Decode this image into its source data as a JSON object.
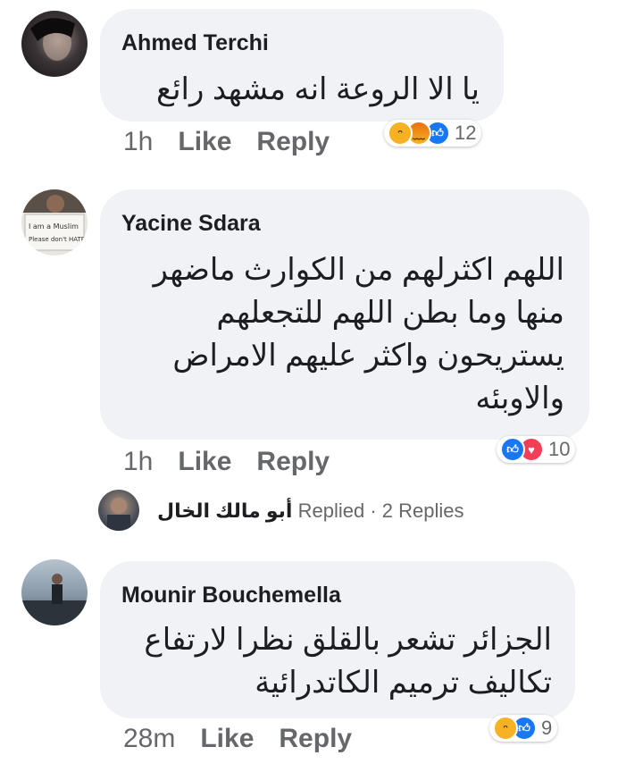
{
  "comments": [
    {
      "author": "Ahmed Terchi",
      "text_lines": [
        "يا الا الروعة  انه مشهد رائع"
      ],
      "time": "1h",
      "like_label": "Like",
      "reply_label": "Reply",
      "reactions": [
        "haha",
        "angry",
        "like"
      ],
      "reaction_count": "12"
    },
    {
      "author": "Yacine Sdara",
      "text_lines": [
        "اللهم اكثرلهم من الكوارث ماضهر",
        "منها وما بطن اللهم للتجعلهم",
        "يستريحون واكثر عليهم الامراض",
        "والاوبئه"
      ],
      "time": "1h",
      "like_label": "Like",
      "reply_label": "Reply",
      "reactions": [
        "like",
        "love"
      ],
      "reaction_count": "10",
      "replies": {
        "replier": "أبو مالك الخال",
        "replied_label": "Replied",
        "separator": "·",
        "count_label": "2 Replies"
      }
    },
    {
      "author": "Mounir Bouchemella",
      "text_lines": [
        "الجزائر تشعر بالقلق نظرا لارتفاع",
        "تكاليف ترميم الكاتدرائية"
      ],
      "time": "28m",
      "like_label": "Like",
      "reply_label": "Reply",
      "reactions": [
        "haha",
        "like"
      ],
      "reaction_count": "9"
    }
  ],
  "colors": {
    "bubble": "#f0f2f5",
    "meta_gray": "#65676b",
    "like_blue": "#1877f2",
    "love_red": "#f33e58",
    "haha_yellow": "#f7b125"
  }
}
